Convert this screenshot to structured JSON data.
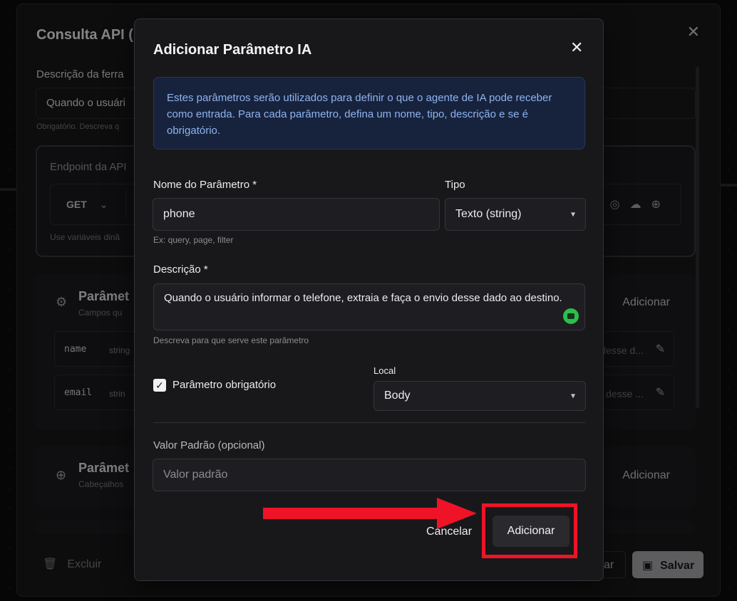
{
  "background": {
    "title": "Consulta API (",
    "description_label": "Descrição da ferra",
    "description_value": "Quando o usuári",
    "description_hint": "Obrigatório. Descreva q",
    "endpoint_label": "Endpoint da API",
    "method": "GET",
    "endpoint_note": "Use variáveis dinâ",
    "section_body": {
      "title": "Parâmet",
      "subtitle": "Campos qu",
      "add_label": "Adicionar",
      "params": [
        {
          "name": "name",
          "type": "string",
          "desc": "desse d..."
        },
        {
          "name": "email",
          "type": "strin",
          "desc": "desse ..."
        }
      ]
    },
    "section_headers": {
      "title": "Parâmet",
      "subtitle": "Cabeçalhos",
      "add_label": "Adicionar"
    },
    "footer": {
      "delete_label": "Excluir",
      "cancel_fragment": "ar",
      "save_label": "Salvar"
    }
  },
  "modal": {
    "title": "Adicionar Parâmetro IA",
    "info_text": "Estes parâmetros serão utilizados para definir o que o agente de IA pode receber como entrada. Para cada parâmetro, defina um nome, tipo, descrição e se é obrigatório.",
    "name_label": "Nome do Parâmetro *",
    "name_value": "phone",
    "name_hint": "Ex: query, page, filter",
    "type_label": "Tipo",
    "type_value": "Texto (string)",
    "description_label": "Descrição *",
    "description_value": "Quando o usuário informar o telefone, extraia e faça o envio desse dado ao destino.",
    "description_hint": "Descreva para que serve este parâmetro",
    "required_label": "Parâmetro obrigatório",
    "required_checked": true,
    "location_label": "Local",
    "location_value": "Body",
    "default_label": "Valor Padrão (opcional)",
    "default_placeholder": "Valor padrão",
    "cancel_label": "Cancelar",
    "add_label": "Adicionar"
  },
  "colors": {
    "highlight": "#ee1327",
    "info_bg": "#17233d",
    "info_text": "#8fb3ef"
  }
}
